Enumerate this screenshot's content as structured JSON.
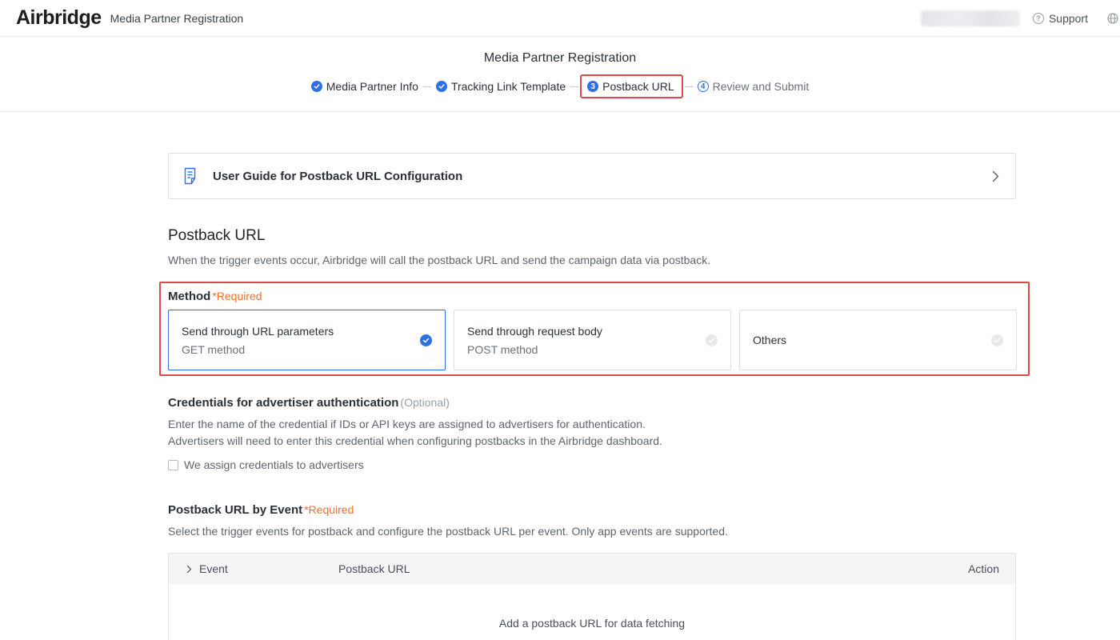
{
  "header": {
    "logo": "Airbridge",
    "app_title": "Media Partner Registration",
    "support_label": "Support"
  },
  "stepper": {
    "title": "Media Partner Registration",
    "steps": [
      {
        "label": "Media Partner Info",
        "state": "done"
      },
      {
        "label": "Tracking Link Template",
        "state": "done"
      },
      {
        "label": "Postback URL",
        "state": "active",
        "number": "3"
      },
      {
        "label": "Review and Submit",
        "state": "pending",
        "number": "4"
      }
    ]
  },
  "guide": {
    "label": "User Guide for Postback URL Configuration"
  },
  "postback": {
    "title": "Postback URL",
    "description": "When the trigger events occur, Airbridge will call the postback URL and send the campaign data via postback."
  },
  "method": {
    "label": "Method",
    "required": "*Required",
    "options": [
      {
        "title": "Send through URL parameters",
        "subtitle": "GET method",
        "selected": true
      },
      {
        "title": "Send through request body",
        "subtitle": "POST method",
        "selected": false
      },
      {
        "title": "Others",
        "subtitle": "",
        "selected": false
      }
    ]
  },
  "credentials": {
    "label": "Credentials for advertiser authentication",
    "optional": "(Optional)",
    "desc_line1": "Enter the name of the credential if IDs or API keys are assigned to advertisers for authentication.",
    "desc_line2": "Advertisers will need to enter this credential when configuring postbacks in the Airbridge dashboard.",
    "checkbox_label": "We assign credentials to advertisers",
    "checked": false
  },
  "events": {
    "label": "Postback URL by Event",
    "required": "*Required",
    "description": "Select the trigger events for postback and configure the postback URL per event. Only app events are supported.",
    "columns": [
      "Event",
      "Postback URL",
      "Action"
    ],
    "empty_text": "Add a postback URL for data fetching"
  },
  "colors": {
    "accent": "#2f6fe4",
    "highlight": "#e0484a",
    "required": "#f0712c"
  }
}
